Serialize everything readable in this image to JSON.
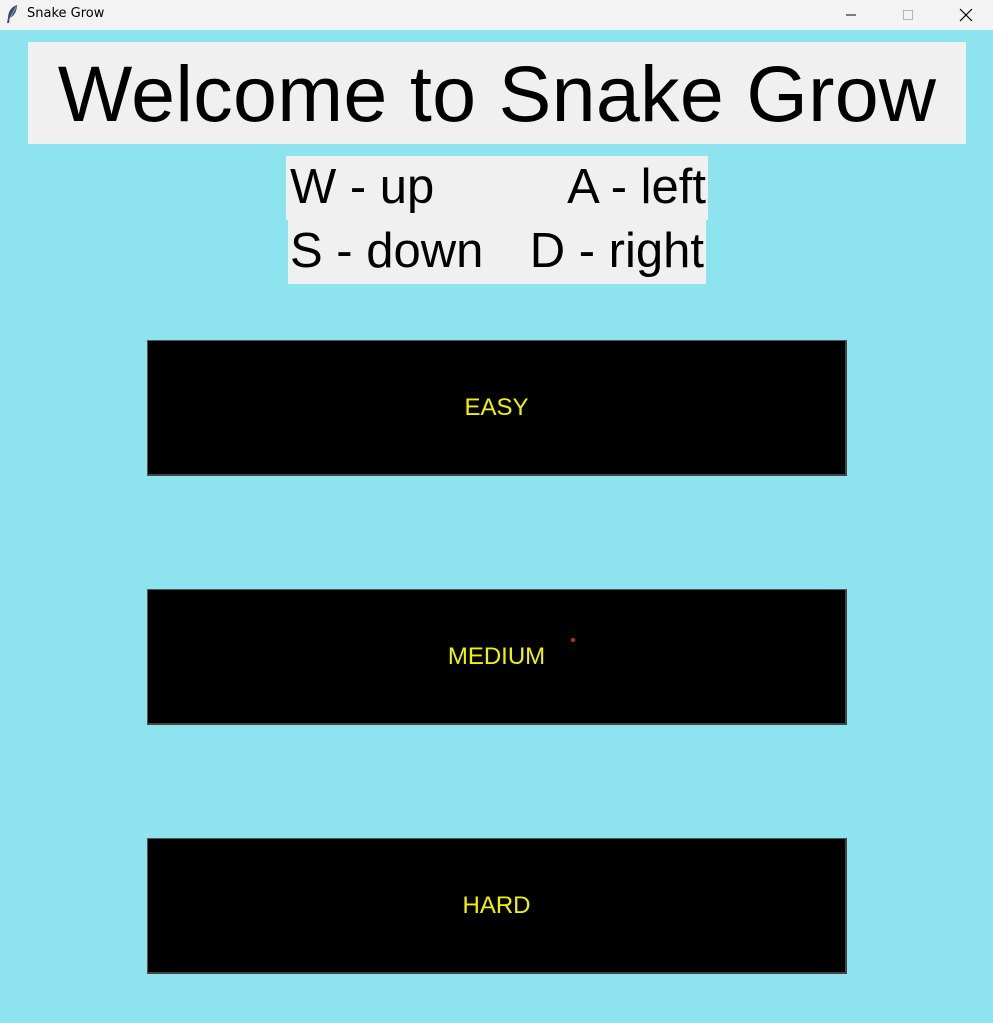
{
  "window": {
    "title": "Snake Grow",
    "app_icon": "feather-icon",
    "controls": [
      "minimize-icon",
      "maximize-icon",
      "close-icon"
    ]
  },
  "heading": {
    "text": "Welcome to Snake Grow"
  },
  "controls_help": {
    "up": "W - up",
    "left": "A - left",
    "down": "S - down",
    "right": "D - right"
  },
  "levels": {
    "easy": "EASY",
    "medium": "MEDIUM",
    "hard": "HARD"
  },
  "colors": {
    "background": "#8ee4ee",
    "label_background": "#f0f0f0",
    "button_background": "#000000",
    "button_text": "#f2f200"
  }
}
